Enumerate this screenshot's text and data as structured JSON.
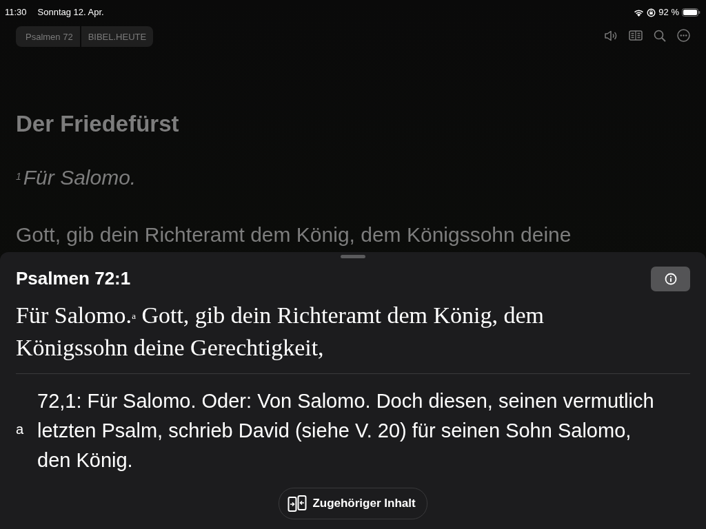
{
  "status_bar": {
    "time": "11:30",
    "date": "Sonntag 12. Apr.",
    "battery": "92 %"
  },
  "toolbar": {
    "buttons": [
      "Psalmen 72",
      "BIBEL.HEUTE"
    ]
  },
  "chapter": {
    "heading": "Der Friedefürst",
    "verse_number": "1",
    "superscription": "Für Salomo.",
    "text": "Gott, gib dein Richteramt dem König, dem Königssohn deine"
  },
  "sheet": {
    "title": "Psalmen 72:1",
    "verse": "Für Salomo.$^{a}$ Gott, gib dein Richteramt dem König,  dem Königssohn deine Gerechtigkeit,",
    "footnote": {
      "mark": "a",
      "text": "72,1: Für Salomo. Oder: Von Salomo. Doch diesen, seinen vermutlich letzten Psalm, schrieb David (siehe V. 20) für seinen Sohn Salomo, den König."
    },
    "button": "Zugehöriger Inhalt"
  }
}
